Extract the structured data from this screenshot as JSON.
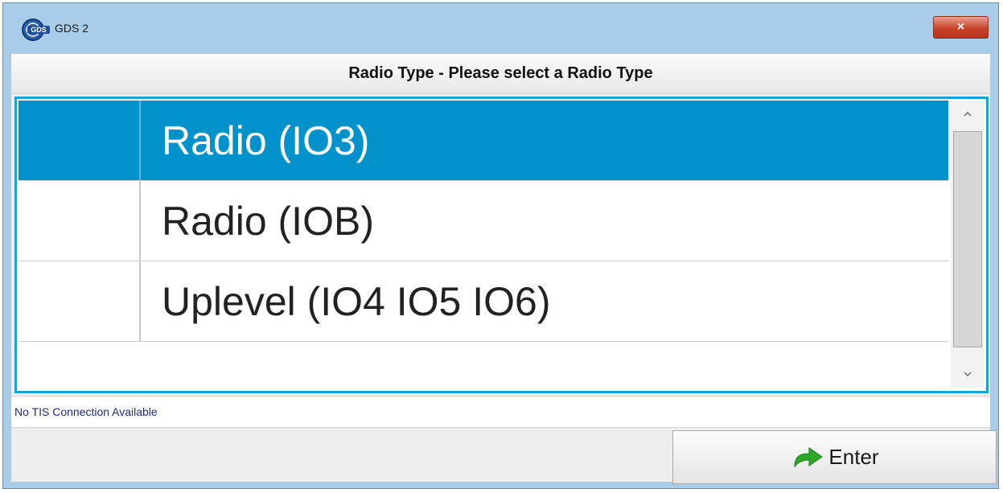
{
  "window": {
    "title": "GDS 2",
    "close_label": "×"
  },
  "header": {
    "title": "Radio Type - Please select a Radio Type"
  },
  "list": {
    "items": [
      {
        "label": "Radio (IO3)",
        "selected": true
      },
      {
        "label": "Radio (IOB)",
        "selected": false
      },
      {
        "label": "Uplevel (IO4 IO5 IO6)",
        "selected": false
      }
    ],
    "scroll_up_icon": "chevron-up-icon",
    "scroll_down_icon": "chevron-down-icon"
  },
  "status": {
    "text": "No TIS Connection Available"
  },
  "footer": {
    "enter_label": "Enter",
    "enter_icon": "green-arrow-icon"
  },
  "colors": {
    "title_bar": "#a9cde9",
    "selection": "#0192cb",
    "list_border": "#1ca1d2",
    "close_button": "#c9432b",
    "arrow_green": "#2fa82a"
  }
}
